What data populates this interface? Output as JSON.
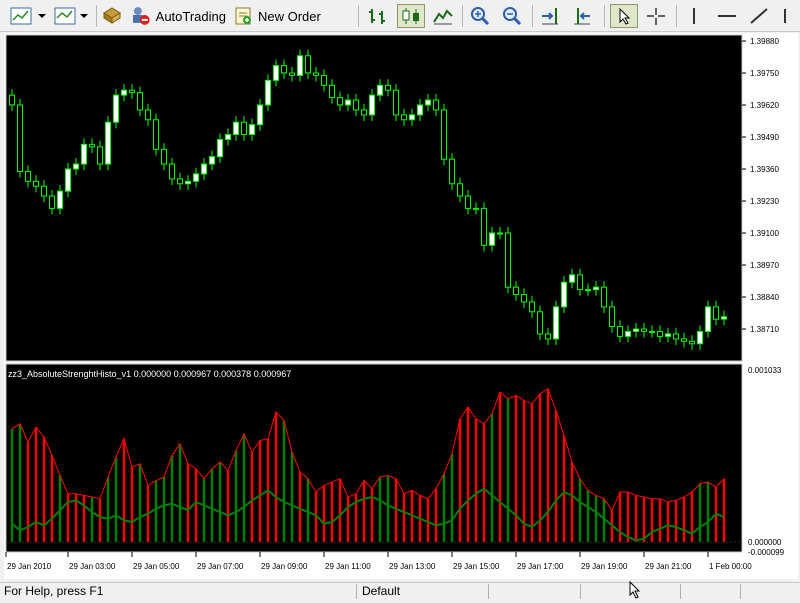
{
  "toolbar": {
    "autotrading_label": "AutoTrading",
    "new_order_label": "New Order"
  },
  "price_chart": {
    "y_ticks": [
      "1.39880",
      "1.39750",
      "1.39620",
      "1.39490",
      "1.39360",
      "1.39230",
      "1.39100",
      "1.38970",
      "1.38840",
      "1.38710"
    ],
    "candles_close": [
      1.3962,
      1.3935,
      1.3931,
      1.3929,
      1.3925,
      1.392,
      1.3927,
      1.3936,
      1.3938,
      1.3946,
      1.3945,
      1.3938,
      1.3955,
      1.3966,
      1.3968,
      1.3967,
      1.396,
      1.3956,
      1.3944,
      1.3938,
      1.3932,
      1.393,
      1.3931,
      1.3934,
      1.3938,
      1.3941,
      1.3948,
      1.395,
      1.3955,
      1.395,
      1.3954,
      1.3962,
      1.3972,
      1.3978,
      1.3975,
      1.3974,
      1.3982,
      1.3975,
      1.3974,
      1.397,
      1.3965,
      1.3962,
      1.3964,
      1.396,
      1.3958,
      1.3966,
      1.397,
      1.3968,
      1.3958,
      1.3956,
      1.3958,
      1.3962,
      1.3964,
      1.396,
      1.394,
      1.393,
      1.3925,
      1.392,
      1.392,
      1.3905,
      1.391,
      1.391,
      1.3888,
      1.3885,
      1.3882,
      1.3878,
      1.3869,
      1.3867,
      1.388,
      1.389,
      1.3893,
      1.3887,
      1.3887,
      1.3888,
      1.388,
      1.3872,
      1.3868,
      1.387,
      1.3871,
      1.387,
      1.387,
      1.3868,
      1.3869,
      1.3867,
      1.3866,
      1.3865,
      1.387,
      1.388,
      1.3875,
      1.3876
    ],
    "bullish_color": "#00ff00",
    "bearish_color": "#000000",
    "candle_body_bull_fill": "#ffffff"
  },
  "indicator": {
    "title": "zz3_AbsoluteStrenghtHisto_v1 0.000000 0.000967 0.000378 0.000967",
    "y_ticks": [
      "0.001033",
      "0.000000",
      "-0.000099"
    ],
    "bars": [
      0.00068,
      0.00071,
      0.0006,
      0.00069,
      0.00063,
      0.00052,
      0.0004,
      0.00029,
      0.00029,
      0.00028,
      0.00027,
      0.00026,
      0.00039,
      0.00051,
      0.00062,
      0.00045,
      0.00047,
      0.00034,
      0.00037,
      0.00039,
      0.00052,
      0.00059,
      0.00047,
      0.00044,
      0.00038,
      0.00044,
      0.00048,
      0.00043,
      0.00055,
      0.00065,
      0.00054,
      0.00061,
      0.00062,
      0.00078,
      0.00073,
      0.00054,
      0.00042,
      0.00038,
      0.0003,
      0.00034,
      0.00036,
      0.00038,
      0.00027,
      0.00029,
      0.00037,
      0.00032,
      0.00039,
      0.0004,
      0.00038,
      0.00029,
      0.00031,
      0.00028,
      0.00026,
      0.00032,
      0.00041,
      0.00053,
      0.00074,
      0.00081,
      0.00074,
      0.00071,
      0.00077,
      0.0009,
      0.00086,
      0.00088,
      0.00085,
      0.00083,
      0.00089,
      0.00092,
      0.00079,
      0.00064,
      0.00048,
      0.00038,
      0.00031,
      0.00028,
      0.00026,
      0.00019,
      0.0003,
      0.0003,
      0.00028,
      0.00027,
      0.00026,
      0.00026,
      0.00024,
      0.00025,
      0.00027,
      0.0003,
      0.00035,
      0.00036,
      0.00033,
      0.00038
    ],
    "bar_up": [
      true,
      true,
      false,
      false,
      false,
      false,
      true,
      false,
      false,
      false,
      true,
      false,
      true,
      true,
      false,
      false,
      true,
      false,
      true,
      true,
      true,
      true,
      false,
      false,
      true,
      true,
      true,
      false,
      true,
      true,
      false,
      false,
      false,
      false,
      true,
      true,
      false,
      true,
      false,
      false,
      false,
      false,
      false,
      false,
      false,
      false,
      true,
      true,
      false,
      false,
      false,
      false,
      false,
      false,
      true,
      true,
      false,
      false,
      false,
      false,
      true,
      false,
      true,
      false,
      false,
      false,
      false,
      false,
      false,
      false,
      false,
      true,
      true,
      true,
      true,
      false,
      false,
      false,
      false,
      false,
      false,
      false,
      false,
      false,
      false,
      false,
      true,
      true,
      false,
      false
    ],
    "signal": [
      0.00011,
      7e-05,
      9e-05,
      0.00012,
      0.0001,
      0.00014,
      0.00019,
      0.00024,
      0.00025,
      0.00022,
      0.00018,
      0.00015,
      0.00014,
      0.00016,
      0.00013,
      0.00012,
      0.00015,
      0.00017,
      0.0002,
      0.00022,
      0.00023,
      0.00021,
      0.00019,
      0.00024,
      0.00022,
      0.0002,
      0.00018,
      0.00016,
      0.00018,
      0.00021,
      0.00025,
      0.00028,
      0.00031,
      0.00027,
      0.00024,
      0.00022,
      0.0002,
      0.00018,
      0.00016,
      0.00011,
      0.00012,
      0.00016,
      0.00021,
      0.00024,
      0.00026,
      0.00027,
      0.00025,
      0.00022,
      0.0002,
      0.00018,
      0.00016,
      0.00014,
      0.00012,
      0.0001,
      0.00011,
      0.00013,
      0.0002,
      0.00025,
      0.00029,
      0.00032,
      0.00028,
      0.00024,
      0.0002,
      0.00016,
      0.00011,
      9e-05,
      0.00013,
      0.00018,
      0.00025,
      0.0003,
      0.00028,
      0.00024,
      0.00021,
      0.00018,
      0.00014,
      0.0001,
      6e-05,
      3e-05,
      1e-05,
      2e-05,
      6e-05,
      8e-05,
      0.0001,
      9e-05,
      7e-05,
      5e-05,
      9e-05,
      0.00012,
      0.00017,
      0.00015
    ],
    "up_color": "#008000",
    "down_color": "#ff0000",
    "signal_color": "#008000"
  },
  "x_axis": {
    "labels": [
      "29 Jan 2010",
      "29 Jan 03:00",
      "29 Jan 05:00",
      "29 Jan 07:00",
      "29 Jan 09:00",
      "29 Jan 11:00",
      "29 Jan 13:00",
      "29 Jan 15:00",
      "29 Jan 17:00",
      "29 Jan 19:00",
      "29 Jan 21:00",
      "1 Feb 00:00"
    ]
  },
  "status": {
    "help_text": "For Help, press F1",
    "profile_text": "Default"
  }
}
